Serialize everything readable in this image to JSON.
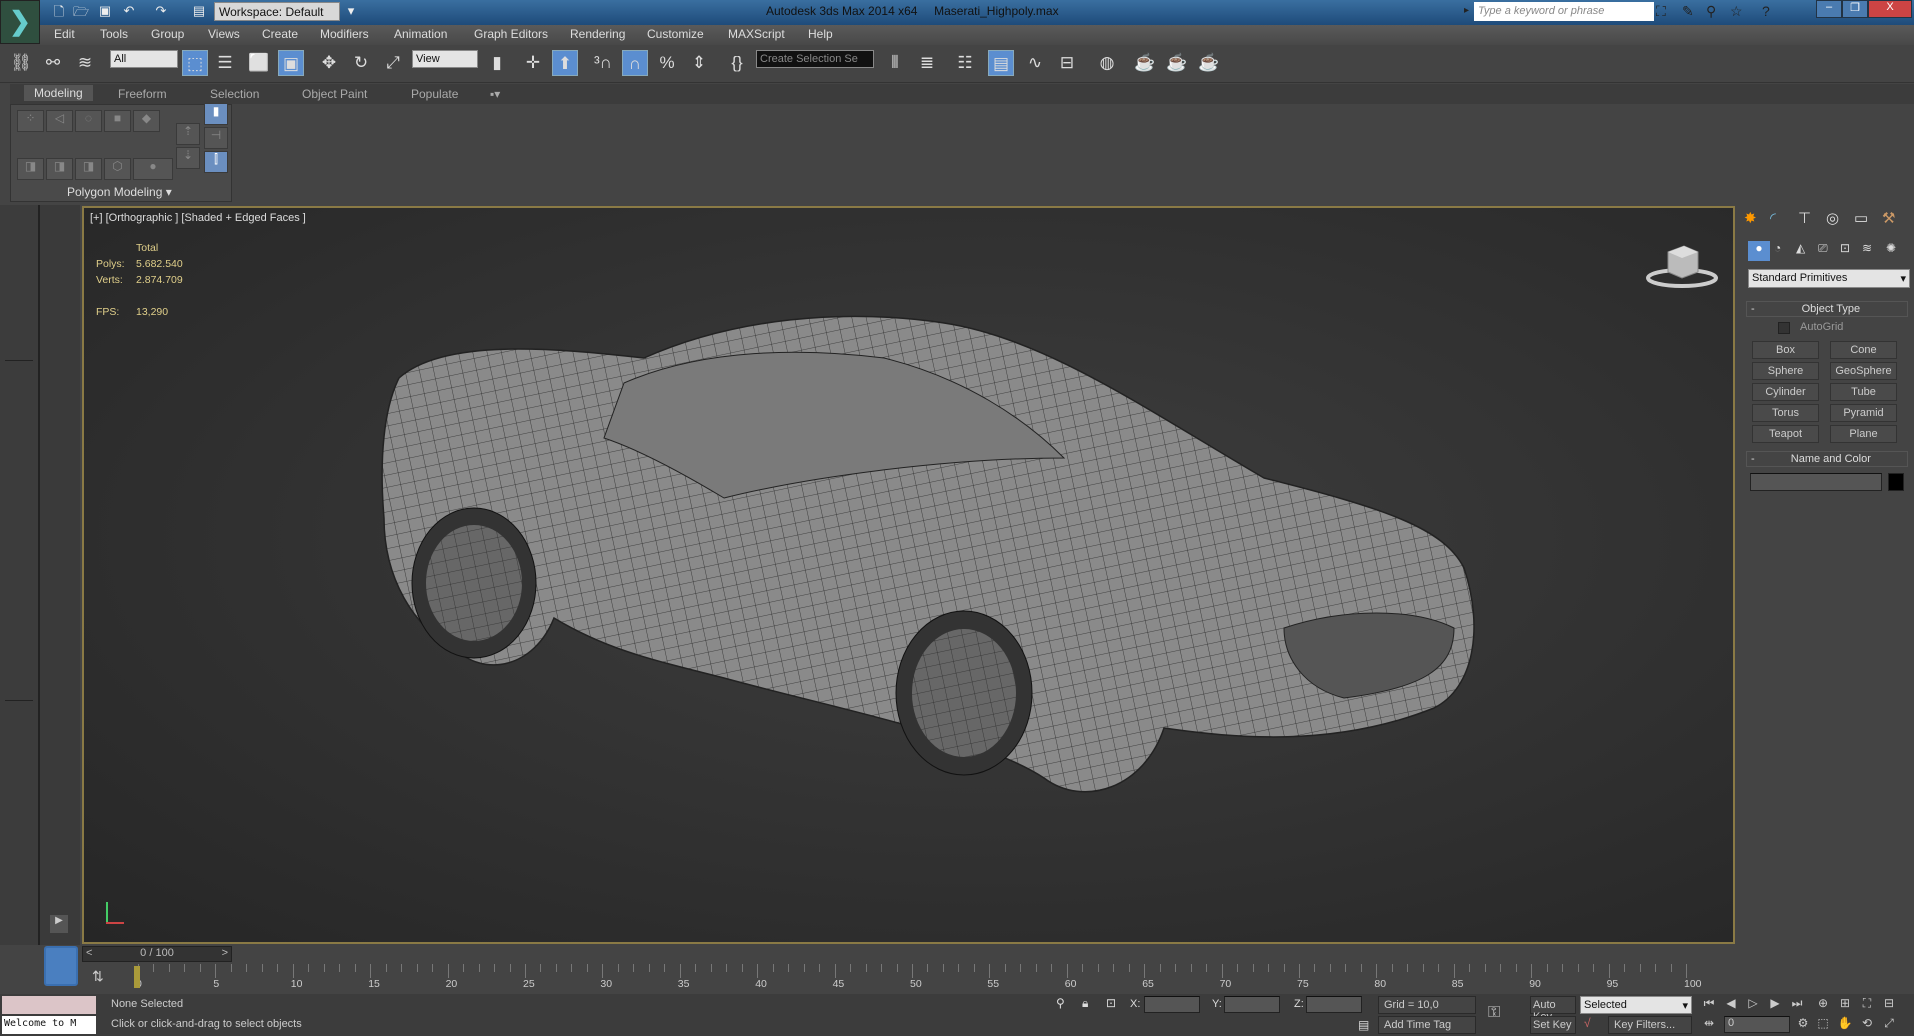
{
  "titlebar": {
    "workspace": "Workspace: Default",
    "app_title": "Autodesk 3ds Max  2014 x64",
    "file_name": "Maserati_Highpoly.max",
    "search_placeholder": "Type a keyword or phrase"
  },
  "menu": [
    "Edit",
    "Tools",
    "Group",
    "Views",
    "Create",
    "Modifiers",
    "Animation",
    "Graph Editors",
    "Rendering",
    "Customize",
    "MAXScript",
    "Help"
  ],
  "toolbar": {
    "filter_value": "All",
    "coord_value": "View",
    "selection_set_placeholder": "Create Selection Se"
  },
  "ribbon": {
    "tabs": [
      "Modeling",
      "Freeform",
      "Selection",
      "Object Paint",
      "Populate"
    ],
    "panel_label": "Polygon Modeling"
  },
  "viewport": {
    "label": "[+] [Orthographic ] [Shaded + Edged Faces ]",
    "stats_header": "Total",
    "polys_label": "Polys:",
    "polys": "5.682.540",
    "verts_label": "Verts:",
    "verts": "2.874.709",
    "fps_label": "FPS:",
    "fps": "13,290"
  },
  "command_panel": {
    "category": "Standard Primitives",
    "object_type_title": "Object Type",
    "autogrid": "AutoGrid",
    "buttons": [
      "Box",
      "Cone",
      "Sphere",
      "GeoSphere",
      "Cylinder",
      "Tube",
      "Torus",
      "Pyramid",
      "Teapot",
      "Plane"
    ],
    "name_color_title": "Name and Color",
    "name_value": "",
    "color": "#000000"
  },
  "timeline": {
    "frame": "0 / 100",
    "ticks": [
      "0",
      "5",
      "10",
      "15",
      "20",
      "25",
      "30",
      "35",
      "40",
      "45",
      "50",
      "55",
      "60",
      "65",
      "70",
      "75",
      "80",
      "85",
      "90",
      "95",
      "100"
    ]
  },
  "status": {
    "listener": "Welcome to M",
    "selection": "None Selected",
    "prompt": "Click or click-and-drag to select objects",
    "x_label": "X:",
    "y_label": "Y:",
    "z_label": "Z:",
    "grid": "Grid = 10,0",
    "add_time_tag": "Add Time Tag",
    "auto_key": "Auto Key",
    "set_key": "Set Key",
    "key_mode": "Selected",
    "key_filters": "Key Filters...",
    "current_frame": "0"
  }
}
